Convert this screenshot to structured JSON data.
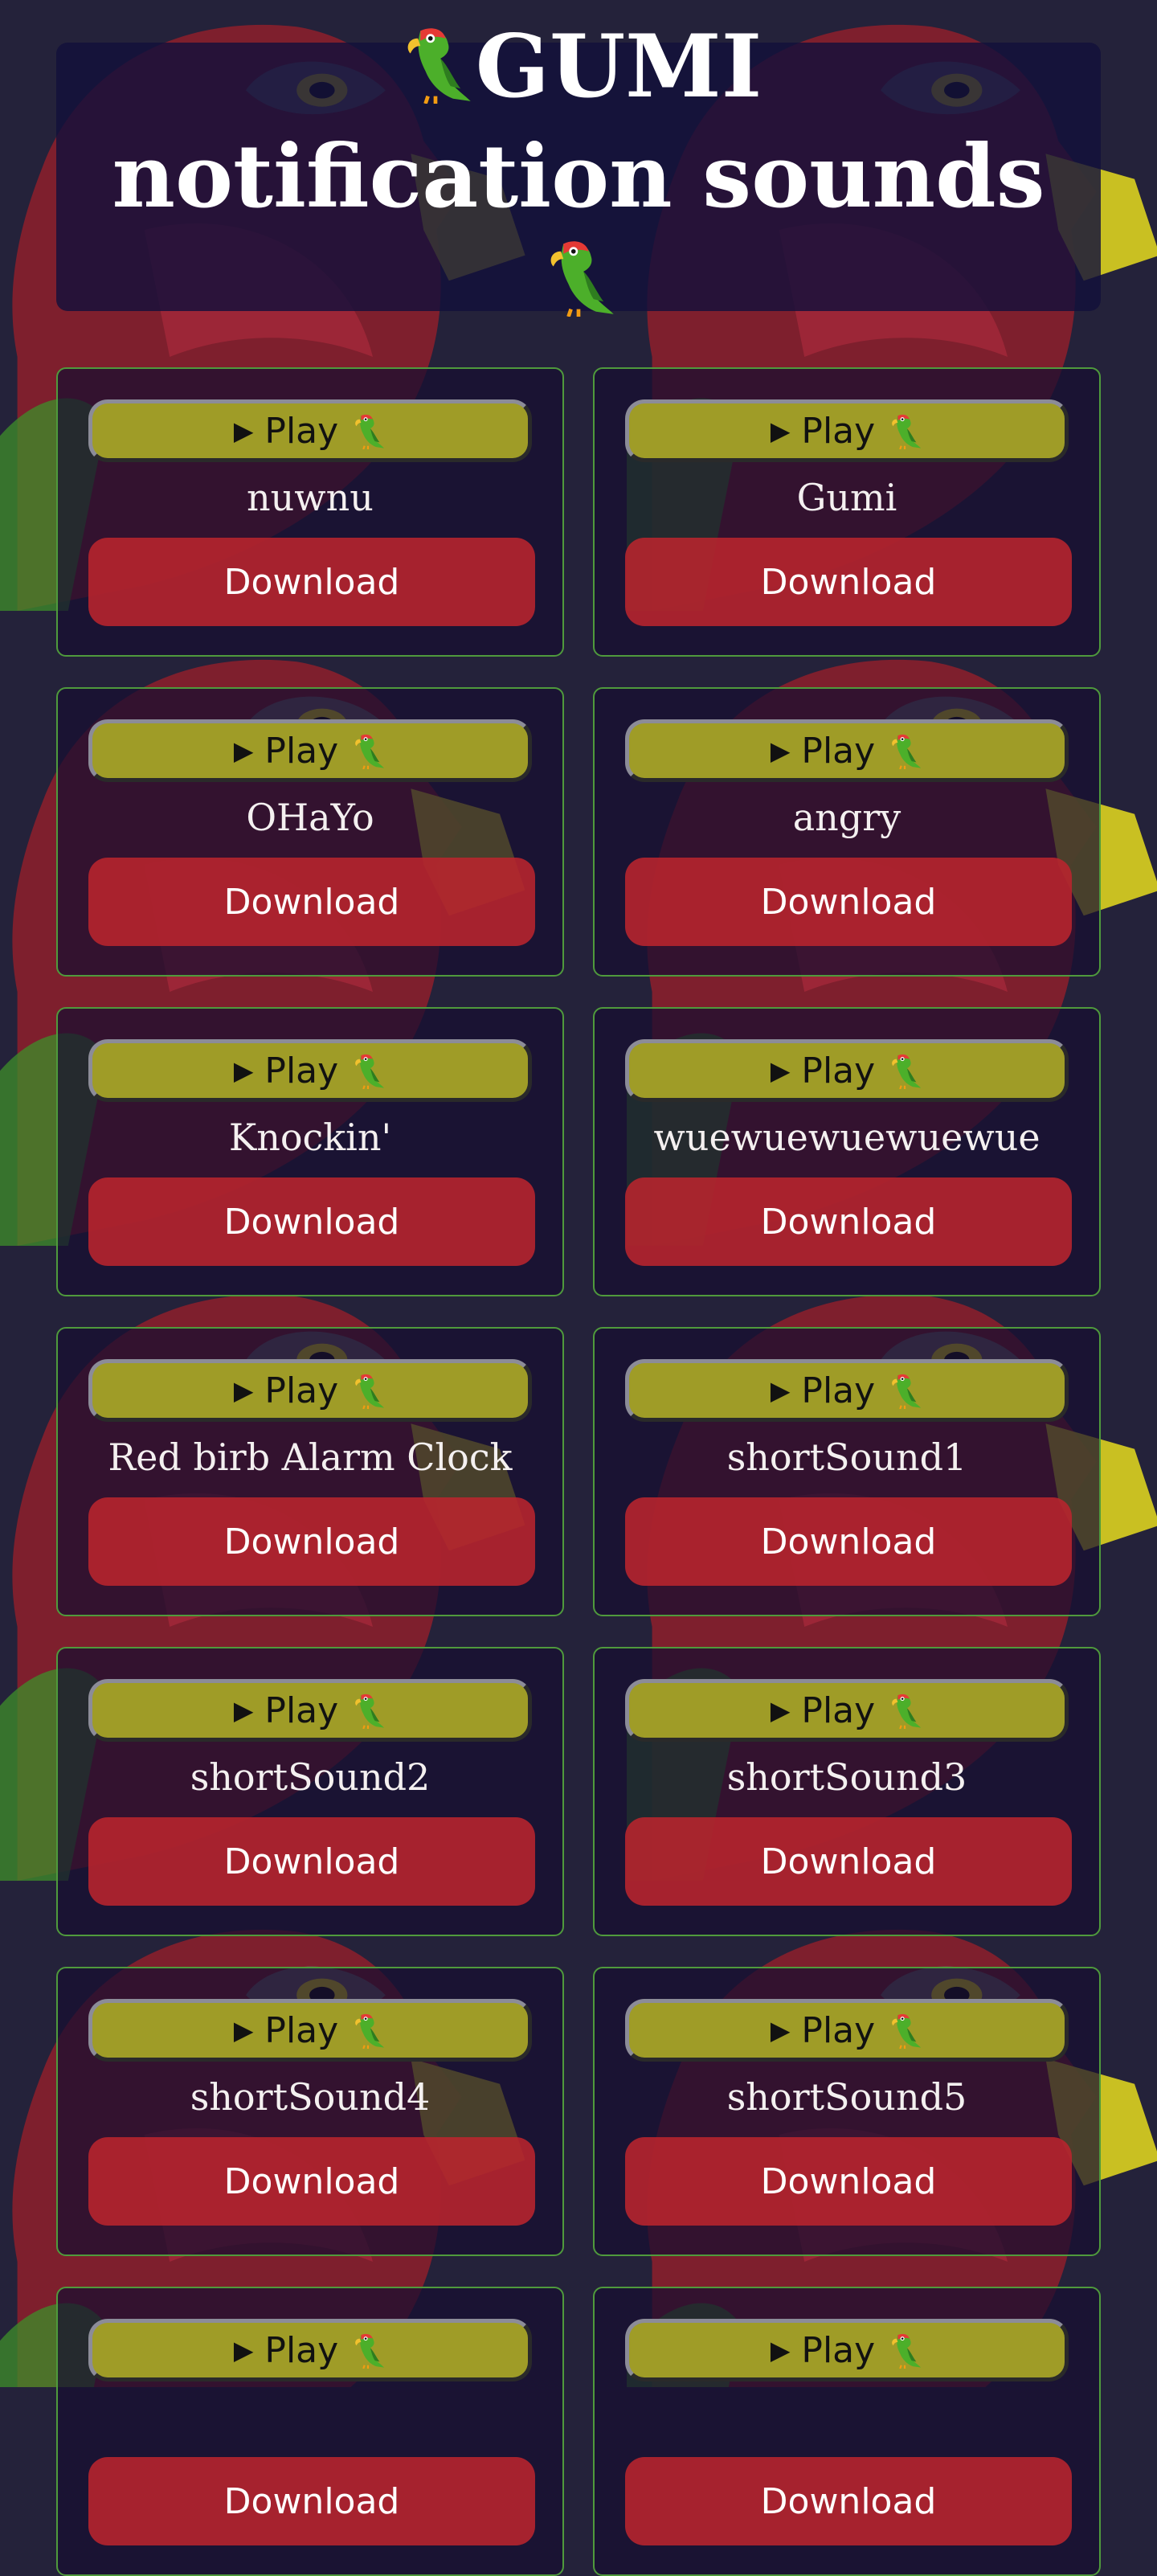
{
  "header": {
    "title": "GUMI notification sounds"
  },
  "play_label": "Play",
  "download_label": "Download",
  "sounds": [
    {
      "name": "nuwnu"
    },
    {
      "name": "Gumi"
    },
    {
      "name": "OHaYo"
    },
    {
      "name": "angry"
    },
    {
      "name": "Knockin'"
    },
    {
      "name": "wuewuewuewuewue"
    },
    {
      "name": "Red birb Alarm Clock"
    },
    {
      "name": "shortSound1"
    },
    {
      "name": "shortSound2"
    },
    {
      "name": "shortSound3"
    },
    {
      "name": "shortSound4"
    },
    {
      "name": "shortSound5"
    },
    {
      "name": ""
    },
    {
      "name": ""
    }
  ],
  "icons": {
    "play": "play-triangle-icon",
    "parrot": "parrot-icon",
    "background": "red-bird-pattern"
  },
  "colors": {
    "background": "#24223a",
    "header_bg": "#12103a",
    "card_border": "#4f9a3c",
    "play_button": "#9f9c27",
    "download_button": "#ba242e",
    "bird_red": "#8e1f2c",
    "bird_green": "#3e8f2a",
    "beak_yellow": "#e6dc1e"
  }
}
